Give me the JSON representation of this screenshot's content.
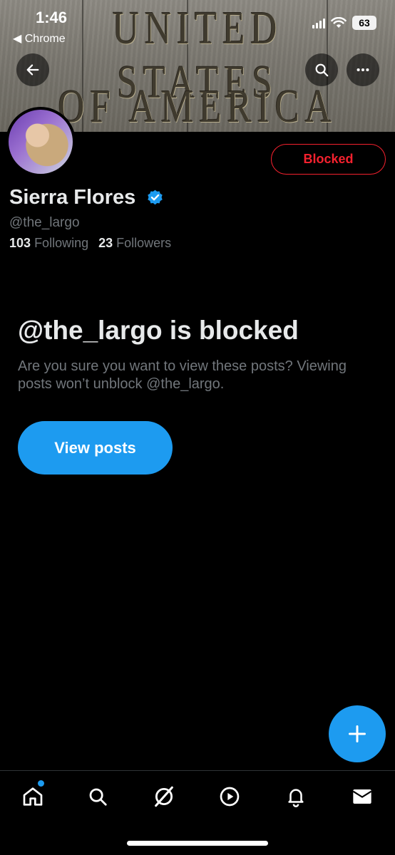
{
  "status_bar": {
    "time": "1:46",
    "back_app": "◀ Chrome",
    "battery": "63"
  },
  "banner": {
    "line1": "UNITED STATES",
    "line2": "OF AMERICA"
  },
  "header": {
    "back_icon": "arrow-left-icon",
    "search_icon": "search-icon",
    "more_icon": "more-horizontal-icon"
  },
  "profile": {
    "display_name": "Sierra Flores",
    "handle": "@the_largo",
    "following_count": "103",
    "following_label": "Following",
    "followers_count": "23",
    "followers_label": "Followers",
    "blocked_button_label": "Blocked",
    "verified_icon": "verified-badge-icon"
  },
  "blocked_notice": {
    "title": "@the_largo is blocked",
    "description": "Are you sure you want to view these posts? Viewing posts won’t unblock @the_largo.",
    "view_posts_label": "View posts"
  },
  "fab": {
    "icon": "plus-icon"
  },
  "bottom_nav": {
    "items": [
      "home-icon",
      "search-icon",
      "grok-icon",
      "video-icon",
      "notifications-icon",
      "messages-icon"
    ]
  },
  "colors": {
    "accent": "#1d9bf0",
    "blocked_red": "#f4212e",
    "muted_text": "#71767b",
    "primary_text": "#e7e9ea",
    "background": "#000000"
  }
}
